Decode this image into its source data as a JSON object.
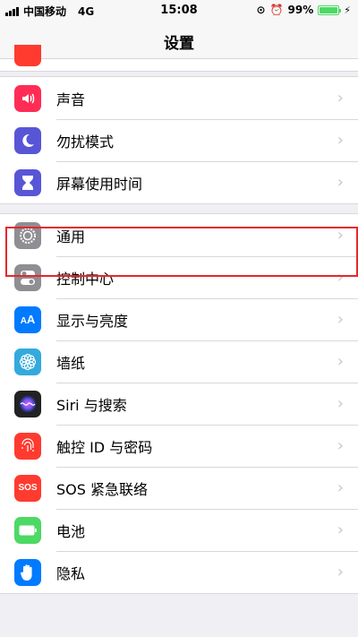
{
  "status_bar": {
    "carrier": "中国移动",
    "network": "4G",
    "time": "15:08",
    "battery": "99%",
    "battery_level": 0.99
  },
  "nav": {
    "title": "设置"
  },
  "group1": [
    {
      "label": "声音",
      "icon": "speaker-icon",
      "color": "#ff2d55"
    },
    {
      "label": "勿扰模式",
      "icon": "moon-icon",
      "color": "#5856d6"
    },
    {
      "label": "屏幕使用时间",
      "icon": "hourglass-icon",
      "color": "#5856d6"
    }
  ],
  "group2": [
    {
      "label": "通用",
      "icon": "gear-icon",
      "color": "#8e8e93"
    },
    {
      "label": "控制中心",
      "icon": "toggles-icon",
      "color": "#8e8e93"
    },
    {
      "label": "显示与亮度",
      "icon": "text-size-icon",
      "color": "#007aff"
    },
    {
      "label": "墙纸",
      "icon": "flower-icon",
      "color": "#34aadc"
    },
    {
      "label": "Siri 与搜索",
      "icon": "siri-icon",
      "color": "#222222"
    },
    {
      "label": "触控 ID 与密码",
      "icon": "fingerprint-icon",
      "color": "#ff3b30"
    },
    {
      "label": "SOS 紧急联络",
      "icon": "sos-icon",
      "color": "#ff3b30",
      "icon_text": "SOS"
    },
    {
      "label": "电池",
      "icon": "battery-icon",
      "color": "#4cd964"
    },
    {
      "label": "隐私",
      "icon": "hand-icon",
      "color": "#007aff"
    }
  ],
  "chevron": "›"
}
